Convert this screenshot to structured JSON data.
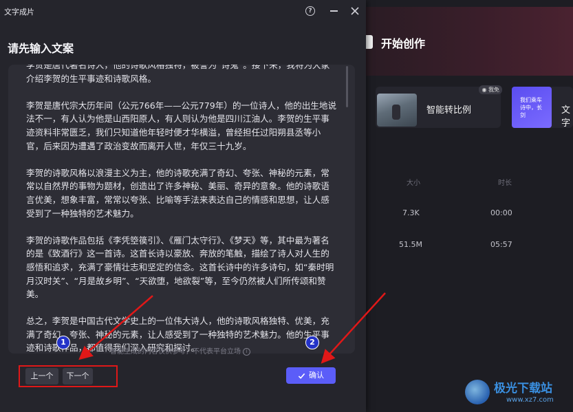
{
  "window": {
    "title": "文字成片"
  },
  "dialog": {
    "heading": "请先输入文案",
    "paragraphs": [
      "李贺是唐代著名诗人，他的诗歌风格独特，被誉为“诗鬼”。接下来，我将为大家介绍李贺的生平事迹和诗歌风格。",
      "李贺是唐代宗大历年间（公元766年——公元779年）的一位诗人，他的出生地说法不一，有人认为他是山西阳原人，有人则认为他是四川江油人。李贺的生平事迹资料非常匮乏，我们只知道他年轻时便才华横溢，曾经担任过阳朔县丞等小官，后来因为遭遇了政治变故而离开人世，年仅三十九岁。",
      "李贺的诗歌风格以浪漫主义为主，他的诗歌充满了奇幻、夸张、神秘的元素，常常以自然界的事物为题材，创造出了许多神秘、美丽、奇异的意象。他的诗歌语言优美，想象丰富，常常以夸张、比喻等手法来表达自己的情感和思想，让人感受到了一种独特的艺术魅力。",
      "李贺的诗歌作品包括《李凭箜篌引》、《雁门太守行》、《梦天》等，其中最为著名的是《致酒行》这一首诗。这首长诗以豪放、奔放的笔触，描绘了诗人对人生的感悟和追求，充满了豪情壮志和坚定的信念。这首长诗中的许多诗句，如“秦时明月汉时关”、“月是故乡明”、“天欲堕，地欲裂”等，至今仍然被人们所传颂和赞美。",
      "总之，李贺是中国古代文学史上的一位伟大诗人，他的诗歌风格独特、优美，充满了奇幻、夸张、神秘的元素，让人感受到了一种独特的艺术魅力。他的生平事迹和诗歌作品，都值得我们深入研究和探讨。"
    ],
    "notice": "智能生成的内容仅供参考，不代表平台立场",
    "prev_label": "上一个",
    "next_label": "下一个",
    "confirm_label": "确认",
    "marker1": "1",
    "marker2": "2"
  },
  "background": {
    "title": "开始创作",
    "card1_label": "智能转比例",
    "card1_badge": "◉ 我免",
    "card2_label": "文字",
    "card2_thumb_text": "我们乘车诗中，长剑",
    "col_size": "大小",
    "col_duration": "时长",
    "rows": [
      {
        "size": "7.3K",
        "duration": "00:00"
      },
      {
        "size": "51.5M",
        "duration": "05:57"
      }
    ]
  },
  "watermark": {
    "title": "极光下载站",
    "url": "www.xz7.com"
  },
  "colors": {
    "accent": "#5b5df8",
    "annotation_red": "#e01818",
    "marker_blue": "#2433c8"
  }
}
